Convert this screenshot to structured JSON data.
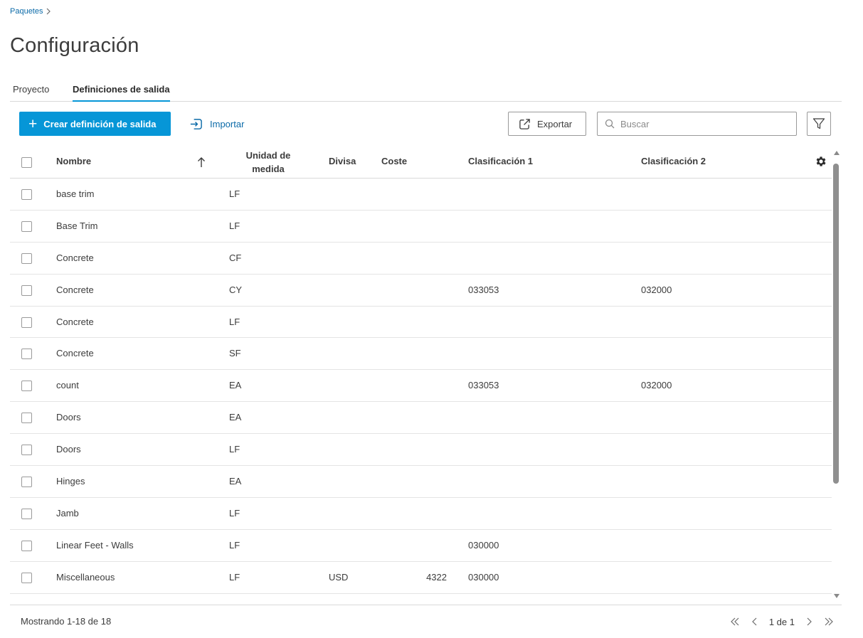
{
  "breadcrumb": {
    "root": "Paquetes"
  },
  "page": {
    "title": "Configuración"
  },
  "tabs": [
    {
      "label": "Proyecto",
      "active": false
    },
    {
      "label": "Definiciones de salida",
      "active": true
    }
  ],
  "toolbar": {
    "create_label": "Crear definición de salida",
    "import_label": "Importar",
    "export_label": "Exportar",
    "search_placeholder": "Buscar",
    "search_value": ""
  },
  "table": {
    "columns": {
      "name": "Nombre",
      "uom_line1": "Unidad de",
      "uom_line2": "medida",
      "currency": "Divisa",
      "cost": "Coste",
      "class1": "Clasificación 1",
      "class2": "Clasificación 2"
    },
    "sort": {
      "column": "Nombre",
      "direction": "ascending"
    },
    "rows": [
      {
        "name": "base trim",
        "uom": "LF",
        "currency": "",
        "cost": "",
        "class1": "",
        "class2": ""
      },
      {
        "name": "Base Trim",
        "uom": "LF",
        "currency": "",
        "cost": "",
        "class1": "",
        "class2": ""
      },
      {
        "name": "Concrete",
        "uom": "CF",
        "currency": "",
        "cost": "",
        "class1": "",
        "class2": ""
      },
      {
        "name": "Concrete",
        "uom": "CY",
        "currency": "",
        "cost": "",
        "class1": "033053",
        "class2": "032000"
      },
      {
        "name": "Concrete",
        "uom": "LF",
        "currency": "",
        "cost": "",
        "class1": "",
        "class2": ""
      },
      {
        "name": "Concrete",
        "uom": "SF",
        "currency": "",
        "cost": "",
        "class1": "",
        "class2": ""
      },
      {
        "name": "count",
        "uom": "EA",
        "currency": "",
        "cost": "",
        "class1": "033053",
        "class2": "032000"
      },
      {
        "name": "Doors",
        "uom": "EA",
        "currency": "",
        "cost": "",
        "class1": "",
        "class2": ""
      },
      {
        "name": "Doors",
        "uom": "LF",
        "currency": "",
        "cost": "",
        "class1": "",
        "class2": ""
      },
      {
        "name": "Hinges",
        "uom": "EA",
        "currency": "",
        "cost": "",
        "class1": "",
        "class2": ""
      },
      {
        "name": "Jamb",
        "uom": "LF",
        "currency": "",
        "cost": "",
        "class1": "",
        "class2": ""
      },
      {
        "name": "Linear Feet - Walls",
        "uom": "LF",
        "currency": "",
        "cost": "",
        "class1": "030000",
        "class2": ""
      },
      {
        "name": "Miscellaneous",
        "uom": "LF",
        "currency": "USD",
        "cost": "4322",
        "class1": "030000",
        "class2": ""
      }
    ]
  },
  "footer": {
    "status": "Mostrando 1-18 de 18",
    "page_info": "1 de 1"
  },
  "colors": {
    "accent": "#0696d7",
    "link": "#0b6aa8"
  },
  "icons": [
    "chevron-right-icon",
    "plus-icon",
    "import-icon",
    "export-icon",
    "search-icon",
    "filter-icon",
    "sort-up-arrow-icon",
    "gear-icon",
    "first-page-icon",
    "prev-page-icon",
    "next-page-icon",
    "last-page-icon"
  ]
}
